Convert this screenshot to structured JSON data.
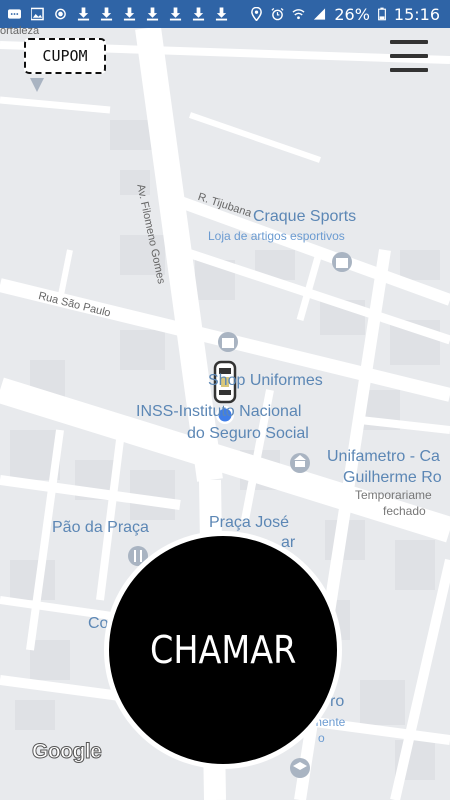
{
  "status_bar": {
    "battery": "26%",
    "time": "15:16",
    "left_icons": [
      "chat-icon",
      "image-icon",
      "record-icon",
      "download-icon",
      "download-icon",
      "download-icon",
      "download-icon",
      "download-icon",
      "download-icon",
      "download-icon"
    ],
    "right_icons": [
      "location-icon",
      "alarm-icon",
      "wifi-icon",
      "signal-icon",
      "battery-icon"
    ]
  },
  "map": {
    "streets": {
      "av_filomeno": "Av. Filomeno Gomes",
      "r_tijubana": "R. Tijubana",
      "rua_sao_paulo": "Rua São Paulo",
      "top_left": "ortaleza"
    },
    "pois": {
      "craque_sports": "Craque Sports",
      "craque_sub": "Loja de artigos esportivos",
      "shop_uniformes": "Shop Uniformes",
      "inss_line1": "INSS-Instituto Nacional",
      "inss_line2": "do Seguro Social",
      "unifametro_line1": "Unifametro - Ca",
      "unifametro_line2": "Guilherme Ro",
      "unifametro_sub1": "Temporariame",
      "unifametro_sub2": "fechado",
      "pao_da_praca": "Pão da Praça",
      "praca_jose": "Praça José",
      "praca_partial": "ar",
      "co_partial": "Co",
      "bottom_partial1": "ro",
      "bottom_partial2": "mente",
      "bottom_partial3": "o"
    }
  },
  "header": {
    "coupon_label": "CUPOM"
  },
  "call_button": {
    "label": "CHAMAR"
  },
  "attribution": {
    "logo_text": "Google"
  }
}
